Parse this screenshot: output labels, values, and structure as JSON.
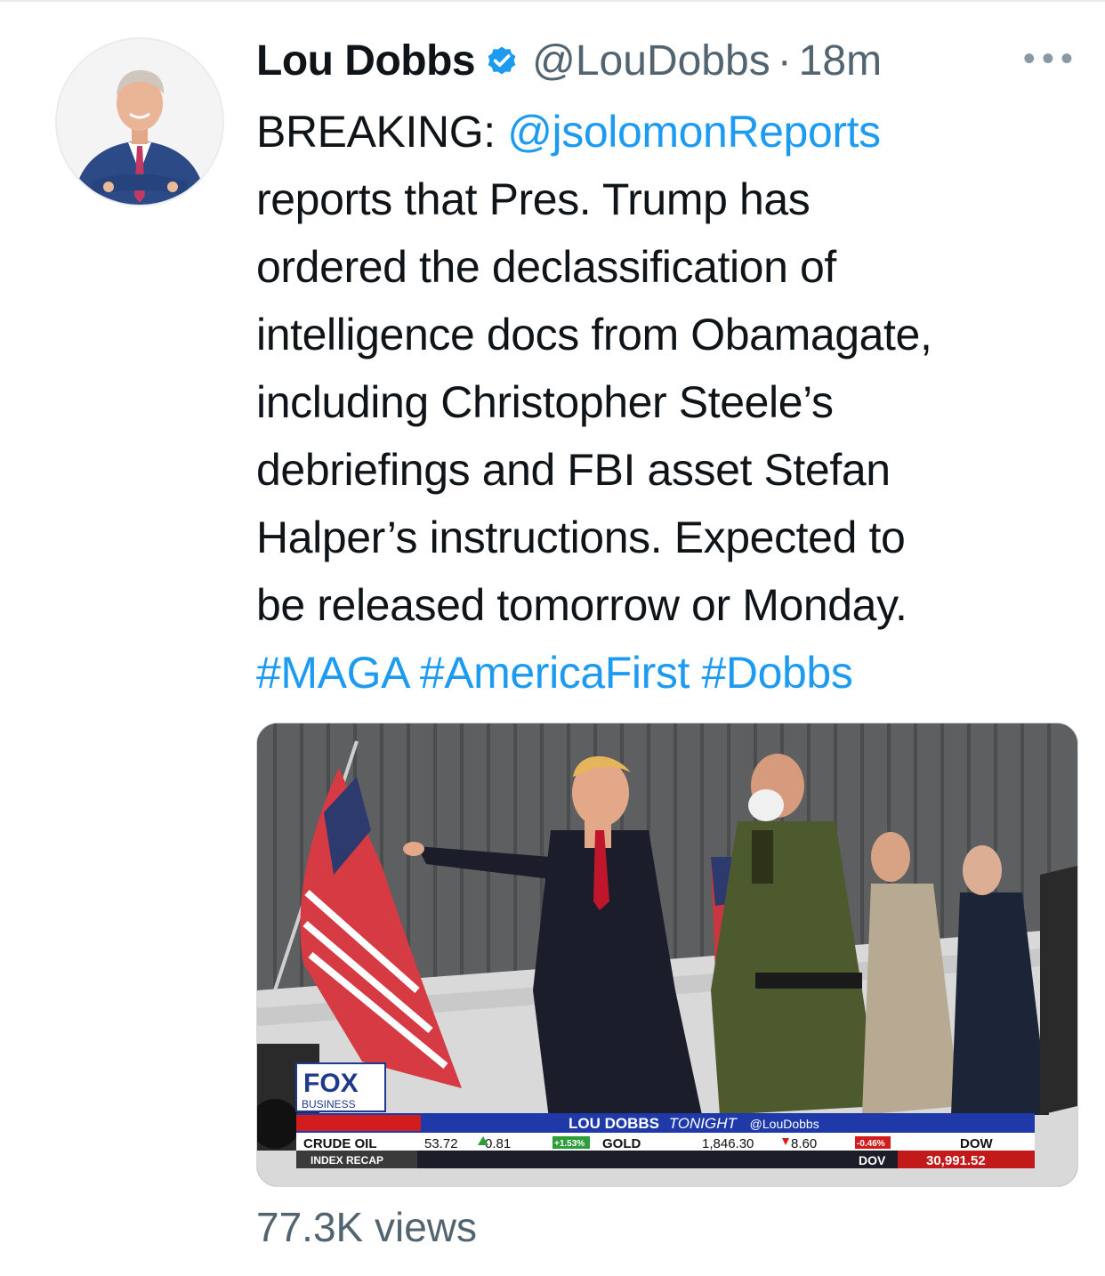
{
  "tweet": {
    "author_name": "Lou Dobbs",
    "handle": "@LouDobbs",
    "separator": "·",
    "time": "18m",
    "more_icon": "ellipsis-icon",
    "verified_icon": "verified-badge-icon",
    "body_lines": [
      {
        "prefix": "BREAKING: ",
        "mention": "@jsolomonReports"
      },
      {
        "text": "reports that Pres. Trump has"
      },
      {
        "text": "ordered the declassification of"
      },
      {
        "text": "intelligence docs from Obamagate,"
      },
      {
        "text": "including Christopher Steele’s"
      },
      {
        "text": "debriefings and FBI asset Stefan"
      },
      {
        "text": "Halper’s instructions. Expected to"
      },
      {
        "text": "be released tomorrow or Monday."
      }
    ],
    "hashtags": [
      "#MAGA",
      "#AmericaFirst",
      "#Dobbs"
    ],
    "views": "77.3K views",
    "colors": {
      "link": "#1d9bf0",
      "muted": "#536471",
      "text": "#0f1419",
      "verified": "#1d9bf0"
    }
  },
  "media": {
    "network_logo": "FOX",
    "network_sub": "BUSINESS",
    "show_title": "LOU DOBBS",
    "show_title_italic": "TONIGHT",
    "show_handle": "@LouDobbs",
    "ticker": {
      "crude_label": "CRUDE OIL",
      "crude_value": "53.72",
      "crude_change": "0.81",
      "crude_pct": "+1.53%",
      "gold_label": "GOLD",
      "gold_value": "1,846.30",
      "gold_change": "8.60",
      "gold_pct": "-0.46%",
      "index_recap": "INDEX RECAP",
      "dow_label": "DOW",
      "dow_label2": "DOV",
      "dow_value": "30,991.52"
    }
  }
}
